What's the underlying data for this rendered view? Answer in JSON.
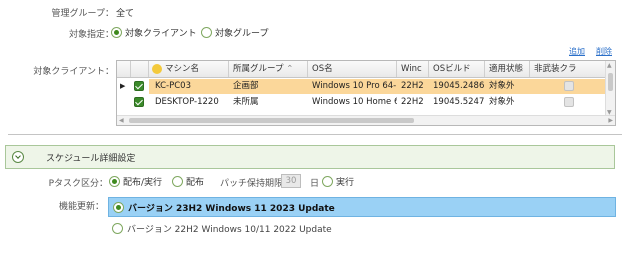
{
  "management_group": {
    "label": "管理グループ：",
    "value": "全て"
  },
  "target_spec": {
    "label": "対象指定：",
    "options": [
      {
        "label": "対象クライアント",
        "selected": true
      },
      {
        "label": "対象グループ",
        "selected": false
      }
    ]
  },
  "links": {
    "add": "追加",
    "delete": "削除"
  },
  "target_clients": {
    "label": "対象クライアント：",
    "columns": [
      "マシン名",
      "所属グループ",
      "OS名",
      "Winc",
      "OSビルド",
      "適用状態",
      "非武装クラ"
    ],
    "rows": [
      {
        "selected": true,
        "checked": true,
        "machine": "KC-PC03",
        "group": "企画部",
        "os": "Windows 10 Pro 64-",
        "win": "22H2",
        "build": "19045.2486",
        "status": "対象外",
        "disarmed": false
      },
      {
        "selected": false,
        "checked": true,
        "machine": "DESKTOP-1220",
        "group": "未所属",
        "os": "Windows 10 Home 6",
        "win": "22H2",
        "build": "19045.5247",
        "status": "対象外",
        "disarmed": false
      }
    ]
  },
  "schedule_section": {
    "title": "スケジュール詳細設定"
  },
  "ptask": {
    "label": "Pタスク区分：",
    "options": [
      {
        "label": "配布/実行",
        "selected": true
      },
      {
        "label": "配布",
        "selected": false
      }
    ],
    "patch_label": "パッチ保持期限",
    "patch_days": "30",
    "days_unit": "日",
    "run_option": {
      "label": "実行",
      "selected": false
    }
  },
  "feature_update": {
    "label": "機能更新：",
    "items": [
      {
        "label": "バージョン 23H2  Windows 11 2023 Update",
        "selected": true
      },
      {
        "label": "バージョン 22H2  Windows 10/11 2022 Update",
        "selected": false
      }
    ]
  },
  "colors": {
    "accent_green": "#3f8a1e",
    "row_highlight": "#fbd79a",
    "list_selection": "#9ad1f5",
    "link_blue": "#2a6fc9"
  }
}
